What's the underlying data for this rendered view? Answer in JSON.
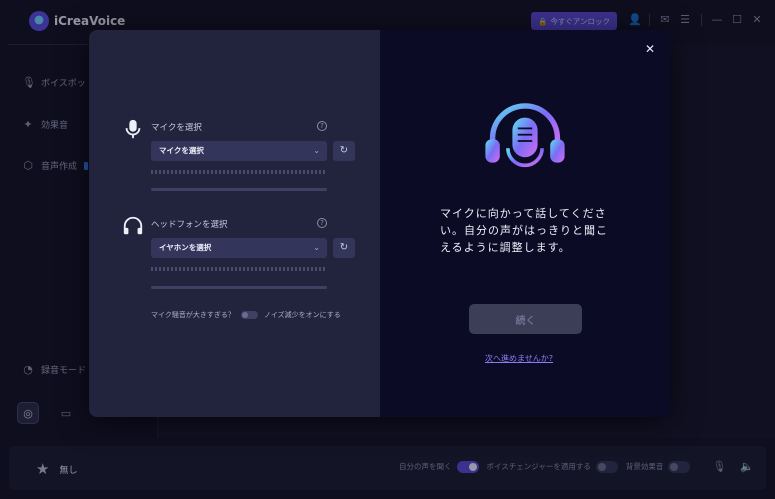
{
  "app": {
    "title": "iCreaVoice",
    "unlock_label": "今すぐアンロック"
  },
  "sidebar": {
    "items": [
      {
        "label": "ボイスボッ",
        "icon": "mic-icon"
      },
      {
        "label": "効果音",
        "icon": "sparkle-icon"
      },
      {
        "label": "音声作成",
        "icon": "box-icon"
      },
      {
        "label": "録音モード",
        "icon": "record-icon"
      }
    ]
  },
  "bottombar": {
    "voice_label": "無し",
    "hear_self_label": "自分の声を聞く",
    "apply_changer_label": "ボイスチェンジャーを適用する",
    "bg_effect_label": "背景効果音"
  },
  "modal": {
    "mic": {
      "label": "マイクを選択",
      "selected": "マイクを選択"
    },
    "headphone": {
      "label": "ヘッドフォンを選択",
      "selected": "イヤホンを選択"
    },
    "noise": {
      "question": "マイク騒音が大きすぎる？",
      "toggle_label": "ノイズ減少をオンにする"
    },
    "guide_text": "マイクに向かって話してください。自分の声がはっきりと聞こえるように調整します。",
    "continue_label": "続く",
    "skip_label": "次へ進めませんか?",
    "help_glyph": "?"
  }
}
